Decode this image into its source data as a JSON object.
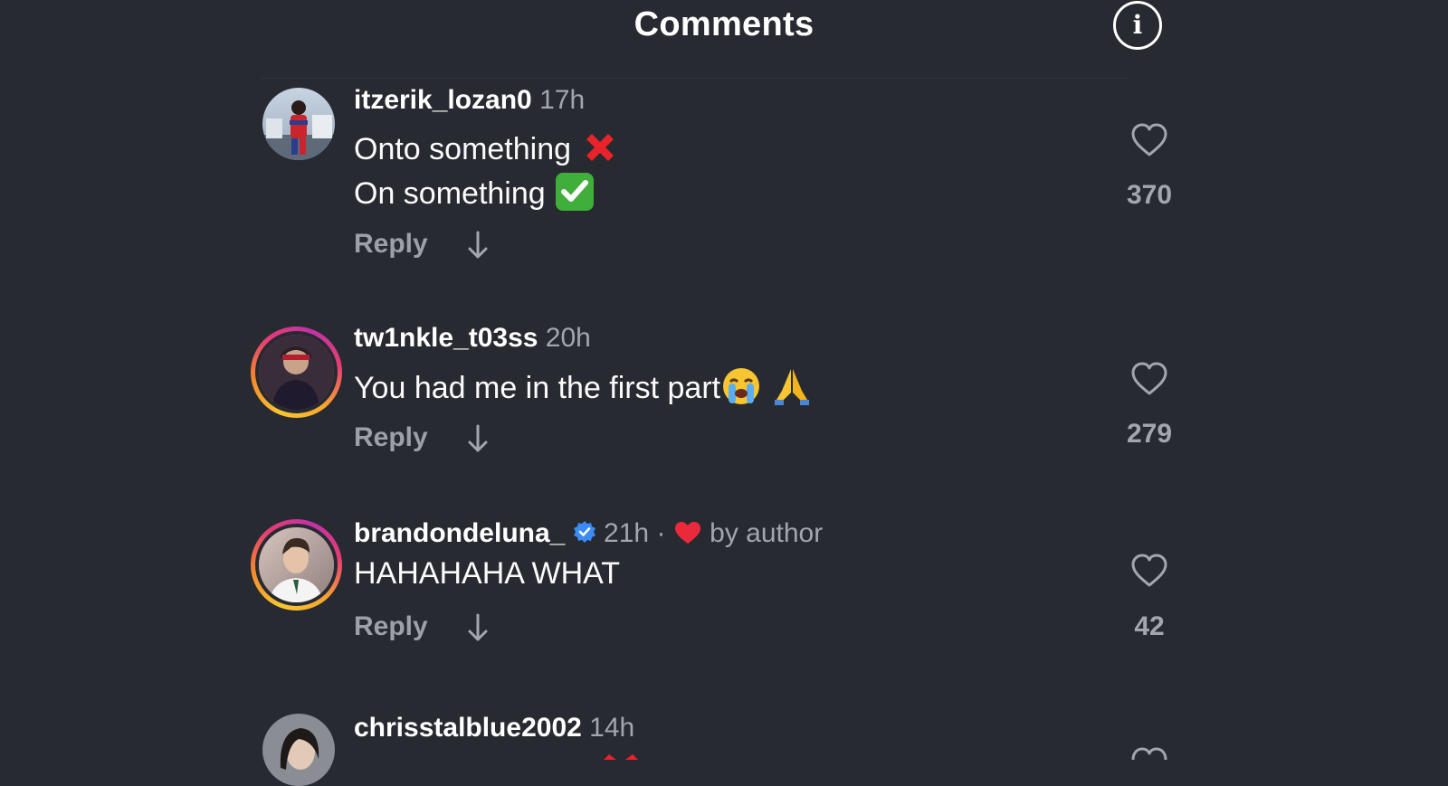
{
  "header": {
    "title": "Comments",
    "info_icon": "info-icon"
  },
  "comments": [
    {
      "username": "itzerik_lozan0",
      "time": "17h",
      "lines": [
        "Onto something",
        "On something"
      ],
      "reply_label": "Reply",
      "likes": "370",
      "emojis": [
        "cross-mark",
        "check-mark-button"
      ]
    },
    {
      "username": "tw1nkle_t03ss",
      "time": "20h",
      "lines": [
        "You had me in the first part"
      ],
      "reply_label": "Reply",
      "likes": "279",
      "emojis": [
        "loudly-crying-face",
        "folded-hands"
      ]
    },
    {
      "username": "brandondeluna_",
      "time": "21h",
      "separator": "·",
      "author_badge": "by author",
      "lines": [
        "HAHAHAHA WHAT"
      ],
      "reply_label": "Reply",
      "likes": "42",
      "verified": true
    },
    {
      "username": "chrisstalblue2002",
      "time": "14h"
    }
  ],
  "colors": {
    "background": "#272a31",
    "meta_text": "#a3a6ad",
    "verified": "#3b8cf5",
    "author_heart": "#ea2a3b"
  }
}
